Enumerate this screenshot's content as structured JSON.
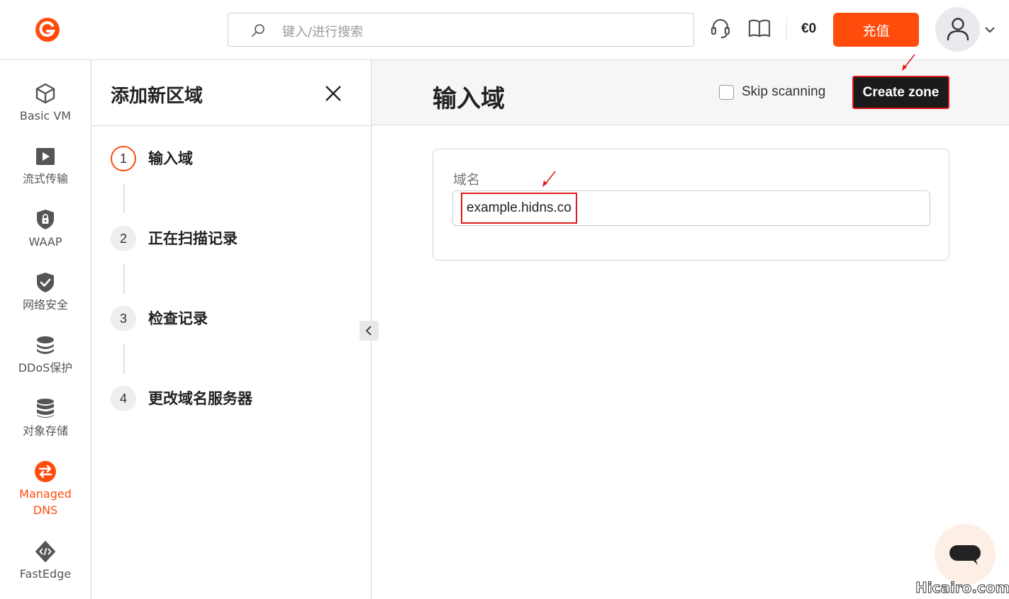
{
  "header": {
    "search_placeholder": "键入/进行搜索",
    "balance": "€0",
    "topup_label": "充值"
  },
  "nav": {
    "items": [
      {
        "label": "Basic VM",
        "icon": "cube-icon"
      },
      {
        "label": "流式传输",
        "icon": "play-icon"
      },
      {
        "label": "WAAP",
        "icon": "shield-lock-icon"
      },
      {
        "label": "网络安全",
        "icon": "shield-check-icon"
      },
      {
        "label": "DDoS保护",
        "icon": "layers-icon"
      },
      {
        "label": "对象存储",
        "icon": "database-icon"
      },
      {
        "label": "Managed DNS",
        "icon": "dns-icon",
        "active": true
      },
      {
        "label": "FastEdge",
        "icon": "code-icon"
      }
    ]
  },
  "wizard": {
    "title": "添加新区域",
    "steps": [
      {
        "number": "1",
        "label": "输入域"
      },
      {
        "number": "2",
        "label": "正在扫描记录"
      },
      {
        "number": "3",
        "label": "检查记录"
      },
      {
        "number": "4",
        "label": "更改域名服务器"
      }
    ]
  },
  "main": {
    "title": "输入域",
    "skip_label": "Skip scanning",
    "skip_checked": false,
    "create_label": "Create zone",
    "field_label": "域名",
    "field_value": "example.hidns.co"
  },
  "watermark": "Hicairo.com",
  "colors": {
    "accent": "#ff4c0d",
    "dark_button": "#1b1b1b",
    "annotation_red": "#e01b1b"
  }
}
